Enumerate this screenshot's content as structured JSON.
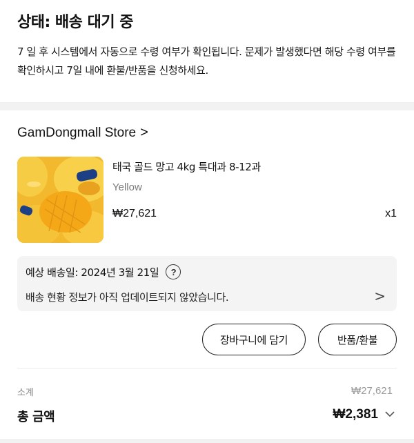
{
  "status": {
    "title": "상태: 배송 대기 중",
    "description": "7 일 후 시스템에서 자동으로 수령 여부가 확인됩니다. 문제가 발생했다면 해당 수령 여부를 확인하시고 7일 내에 환불/반품을 신청하세요."
  },
  "store": {
    "name": "GamDongmall Store",
    "chevron": ">"
  },
  "product": {
    "name": "태국 골드 망고 4kg 특대과 8-12과",
    "option": "Yellow",
    "price": "₩27,621",
    "quantity": "x1",
    "image_icon": "mango-product-image"
  },
  "delivery": {
    "eta": "예상 배송일: 2024년 3월 21일",
    "help_symbol": "?",
    "message": "배송 현황 정보가 아직 업데이트되지 않았습니다.",
    "chevron": ">"
  },
  "actions": {
    "add_to_cart": "장바구니에 담기",
    "return_refund": "반품/환불"
  },
  "summary": {
    "subtotal_label": "소계",
    "subtotal_value": "₩27,621",
    "total_label": "총 금액",
    "total_value": "₩2,381",
    "expand_icon": "chevron-down-icon"
  },
  "colors": {
    "panel_bg": "#f4f4f4",
    "muted_text": "#8a8a8a",
    "mango_yellow": "#f6c23a"
  }
}
